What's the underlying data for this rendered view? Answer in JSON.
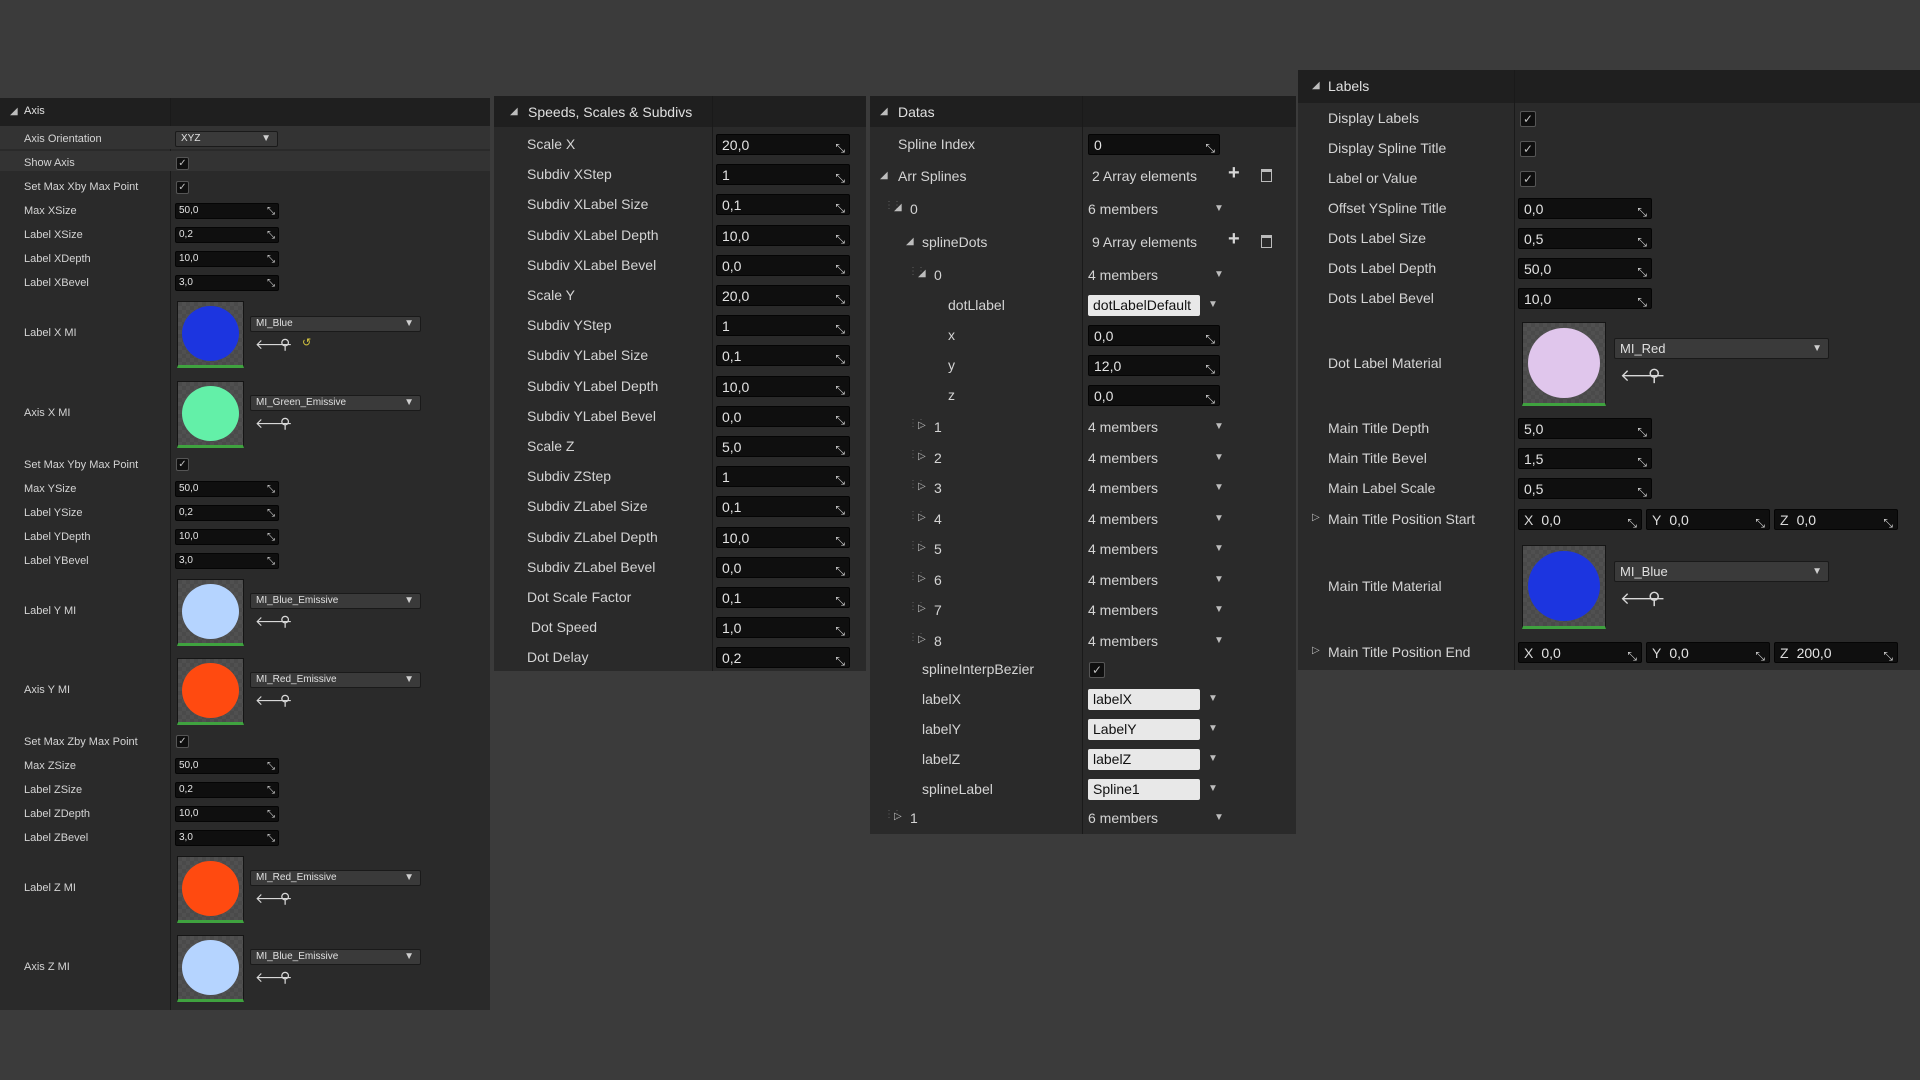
{
  "axis_panel": {
    "title": "Axis",
    "axis_orientation_label": "Axis Orientation",
    "axis_orientation_value": "XYZ",
    "show_axis_label": "Show Axis",
    "x_group": {
      "set_max_label": "Set Max Xby Max Point",
      "max_label": "Max XSize",
      "max_value": "50,0",
      "size_label": "Label XSize",
      "size_value": "0,2",
      "depth_label": "Label XDepth",
      "depth_value": "10,0",
      "bevel_label": "Label XBevel",
      "bevel_value": "3,0",
      "label_mi_label": "Label X MI",
      "label_mi_value": "MI_Blue",
      "axis_mi_label": "Axis X MI",
      "axis_mi_value": "MI_Green_Emissive"
    },
    "y_group": {
      "set_max_label": "Set Max Yby Max Point",
      "max_label": "Max YSize",
      "max_value": "50,0",
      "size_label": "Label YSize",
      "size_value": "0,2",
      "depth_label": "Label YDepth",
      "depth_value": "10,0",
      "bevel_label": "Label YBevel",
      "bevel_value": "3,0",
      "label_mi_label": "Label Y MI",
      "label_mi_value": "MI_Blue_Emissive",
      "axis_mi_label": "Axis Y MI",
      "axis_mi_value": "MI_Red_Emissive"
    },
    "z_group": {
      "set_max_label": "Set Max Zby Max Point",
      "max_label": "Max ZSize",
      "max_value": "50,0",
      "size_label": "Label ZSize",
      "size_value": "0,2",
      "depth_label": "Label ZDepth",
      "depth_value": "10,0",
      "bevel_label": "Label ZBevel",
      "bevel_value": "3,0",
      "label_mi_label": "Label Z MI",
      "label_mi_value": "MI_Red_Emissive",
      "axis_mi_label": "Axis Z MI",
      "axis_mi_value": "MI_Blue_Emissive"
    }
  },
  "speeds_panel": {
    "title": "Speeds, Scales & Subdivs",
    "rows": [
      {
        "label": "Scale X",
        "value": "20,0"
      },
      {
        "label": "Subdiv XStep",
        "value": "1"
      },
      {
        "label": "Subdiv XLabel Size",
        "value": "0,1"
      },
      {
        "label": "Subdiv XLabel Depth",
        "value": "10,0"
      },
      {
        "label": "Subdiv XLabel Bevel",
        "value": "0,0"
      },
      {
        "label": "Scale Y",
        "value": "20,0"
      },
      {
        "label": "Subdiv YStep",
        "value": "1"
      },
      {
        "label": "Subdiv YLabel Size",
        "value": "0,1"
      },
      {
        "label": "Subdiv YLabel Depth",
        "value": "10,0"
      },
      {
        "label": "Subdiv YLabel Bevel",
        "value": "0,0"
      },
      {
        "label": "Scale Z",
        "value": "5,0"
      },
      {
        "label": "Subdiv ZStep",
        "value": "1"
      },
      {
        "label": "Subdiv ZLabel Size",
        "value": "0,1"
      },
      {
        "label": "Subdiv ZLabel Depth",
        "value": "10,0"
      },
      {
        "label": "Subdiv ZLabel Bevel",
        "value": "0,0"
      },
      {
        "label": "Dot Scale Factor",
        "value": "0,1"
      },
      {
        "label": " Dot Speed",
        "value": "1,0"
      },
      {
        "label": "Dot Delay",
        "value": "0,2"
      }
    ]
  },
  "datas_panel": {
    "title": "Datas",
    "spline_index_label": "Spline Index",
    "spline_index_value": "0",
    "arr_splines_label": "Arr Splines",
    "arr_splines_value": "2 Array elements",
    "item0_label": "0",
    "item0_value": "6 members",
    "spline_dots_label": "splineDots",
    "spline_dots_value": "9 Array elements",
    "dot0_label": "0",
    "dot0_value": "4 members",
    "dot_label_label": "dotLlabel",
    "dot_label_value": "dotLabelDefault",
    "x_label": "x",
    "x_value": "0,0",
    "y_label": "y",
    "y_value": "12,0",
    "z_label": "z",
    "z_value": "0,0",
    "dots": [
      {
        "label": "1",
        "value": "4 members"
      },
      {
        "label": "2",
        "value": "4 members"
      },
      {
        "label": "3",
        "value": "4 members"
      },
      {
        "label": "4",
        "value": "4 members"
      },
      {
        "label": "5",
        "value": "4 members"
      },
      {
        "label": "6",
        "value": "4 members"
      },
      {
        "label": "7",
        "value": "4 members"
      },
      {
        "label": "8",
        "value": "4 members"
      }
    ],
    "interp_label": "splineInterpBezier",
    "labelx_label": "labelX",
    "labelx_value": "labelX",
    "labely_label": "labelY",
    "labely_value": "LabelY",
    "labelz_label": "labelZ",
    "labelz_value": "labelZ",
    "spline_label_label": "splineLabel",
    "spline_label_value": "Spline1",
    "item1_label": "1",
    "item1_value": "6 members"
  },
  "labels_panel": {
    "title": "Labels",
    "display_labels": "Display Labels",
    "display_spline_title": "Display Spline Title",
    "label_or_value": "Label or Value",
    "offset_label": "Offset YSpline Title",
    "offset_value": "0,0",
    "dots_size_label": "Dots Label Size",
    "dots_size_value": "0,5",
    "dots_depth_label": "Dots Label Depth",
    "dots_depth_value": "50,0",
    "dots_bevel_label": "Dots Label Bevel",
    "dots_bevel_value": "10,0",
    "dot_material_label": "Dot Label Material",
    "dot_material_value": "MI_Red",
    "main_depth_label": "Main Title Depth",
    "main_depth_value": "5,0",
    "main_bevel_label": "Main Title Bevel",
    "main_bevel_value": "1,5",
    "main_scale_label": "Main Label Scale",
    "main_scale_value": "0,5",
    "pos_start_label": "Main Title Position Start",
    "pos_start": {
      "x_axis": "X",
      "x": "0,0",
      "y_axis": "Y",
      "y": "0,0",
      "z_axis": "Z",
      "z": "0,0"
    },
    "main_material_label": "Main Title Material",
    "main_material_value": "MI_Blue",
    "pos_end_label": "Main Title Position End",
    "pos_end": {
      "x_axis": "X",
      "x": "0,0",
      "y_axis": "Y",
      "y": "0,0",
      "z_axis": "Z",
      "z": "200,0"
    }
  },
  "colors": {
    "blue": "#1c35e0",
    "green_emissive": "#63f0a8",
    "blue_emissive": "#b5d4ff",
    "red_emissive": "#ff4a10",
    "red_dot_material": "#e0c6ec"
  }
}
